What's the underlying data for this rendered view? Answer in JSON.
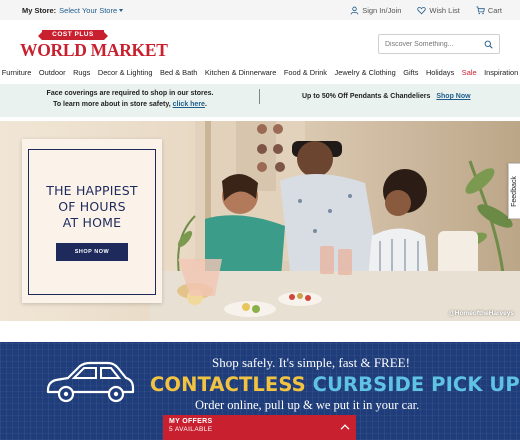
{
  "utility_bar": {
    "store_label": "My Store:",
    "store_link": "Select Your Store",
    "sign_in": "Sign In/Join",
    "wish_list": "Wish List",
    "cart": "Cart"
  },
  "header": {
    "logo_banner": "COST PLUS",
    "logo_name": "WORLD MARKET",
    "search_placeholder": "Discover Something..."
  },
  "nav": {
    "items": [
      "Furniture",
      "Outdoor",
      "Rugs",
      "Decor & Lighting",
      "Bed & Bath",
      "Kitchen & Dinnerware",
      "Food & Drink",
      "Jewelry & Clothing",
      "Gifts",
      "Holidays",
      "Sale",
      "Inspiration"
    ]
  },
  "promo": {
    "line1": "Face coverings are required to shop in our stores.",
    "line2_prefix": "To learn more about in store safety,",
    "line2_link": "click here",
    "line2_suffix": ".",
    "right_text": "Up to 50% Off Pendants & Chandeliers",
    "right_link": "Shop Now"
  },
  "hero": {
    "headline_l1": "THE HAPPIEST",
    "headline_l2": "OF HOURS",
    "headline_l3": "AT HOME",
    "button": "SHOP NOW",
    "credit": "@HomeoftheHarveys"
  },
  "feedback": "Feedback",
  "curbside": {
    "line1": "Shop safely. It's simple, fast & FREE!",
    "big_part1": "CONTACTLESS",
    "big_part2": "CURBSIDE PICK UP",
    "line3": "Order online, pull up & we put it in your car."
  },
  "offers": {
    "title": "MY OFFERS",
    "count": "5 AVAILABLE"
  },
  "colors": {
    "brand_red": "#c8202f",
    "navy": "#1f2a5c",
    "link_blue": "#1f5c8c",
    "promo_bg": "#e9f2ee",
    "curbside_bg": "#1f3d7a",
    "curbside_yellow": "#f2c341",
    "curbside_cyan": "#5fc3e4"
  },
  "icons": {
    "sign_in": "user-icon",
    "wish_list": "heart-icon",
    "cart": "cart-icon",
    "search": "search-icon",
    "store_caret": "caret-down-icon",
    "offers_toggle": "chevron-up-icon"
  }
}
